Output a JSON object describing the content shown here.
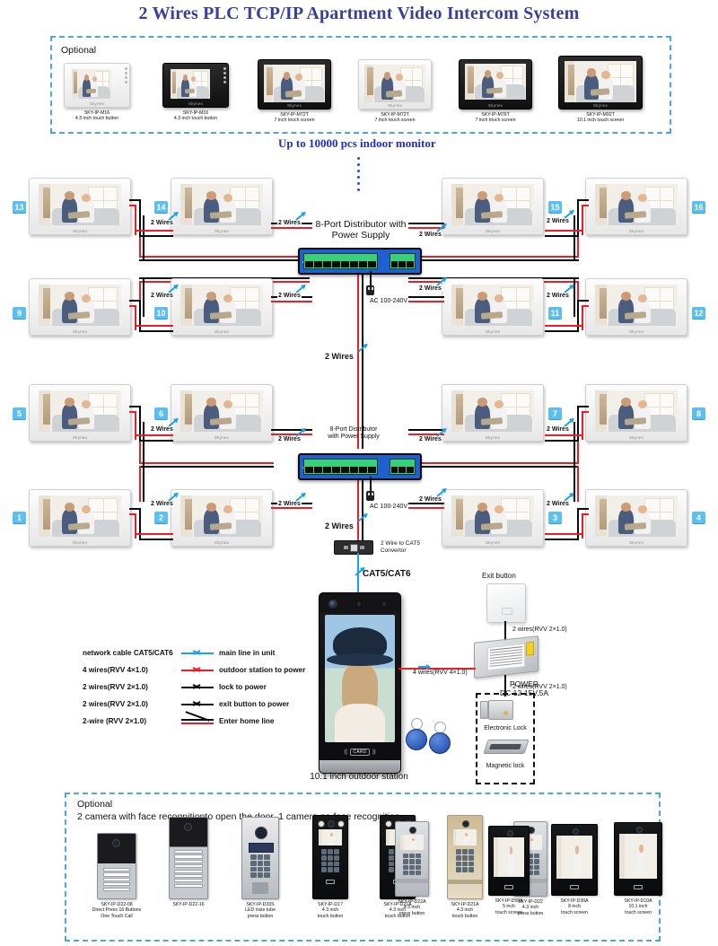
{
  "title": "2 Wires  PLC TCP/IP Apartment Video Intercom System",
  "optional_top": {
    "label": "Optional",
    "products": [
      {
        "model": "SKY-IP-M16",
        "desc": "4.3 inch touch button",
        "color": "white"
      },
      {
        "model": "SKY-IP-M16",
        "desc": "4.3 inch touch button",
        "color": "black"
      },
      {
        "model": "SKY-IP-M72T",
        "desc": "7 inch touch screen",
        "color": "black"
      },
      {
        "model": "SKY-IP-M72T",
        "desc": "7 inch touch screen",
        "color": "white"
      },
      {
        "model": "SKY-IP-M76T",
        "desc": "7 inch touch screen",
        "color": "black"
      },
      {
        "model": "SKY-IP-M92T",
        "desc": "10.1 inch touch screen",
        "color": "black"
      }
    ]
  },
  "capacity_note": "Up to 10000 pcs indoor monitor",
  "monitor_brand": "Skynex",
  "monitor_numbers": [
    "13",
    "14",
    "15",
    "16",
    "9",
    "10",
    "11",
    "12",
    "5",
    "6",
    "7",
    "8",
    "1",
    "2",
    "3",
    "4"
  ],
  "wire_label": "2 Wires",
  "distributors": [
    {
      "title_line1": "8-Port Distributor with",
      "title_line2": "Power Supply",
      "ac": "AC 100-240V"
    },
    {
      "title_line1": "8-Port Distributor",
      "title_line2": "with Power Supply",
      "ac": "AC 100-240V"
    }
  ],
  "converter": {
    "line1": "2 Wire to CAT5",
    "line2": "Convertor",
    "cable_label": "CAT5/CAT6"
  },
  "legend": [
    {
      "left": "network cable CAT5/CAT6",
      "right": "main line in unit",
      "color": "#19a3e8",
      "style": "single"
    },
    {
      "left": "4 wires(RVV 4×1.0)",
      "right": "outdoor station to power",
      "color": "#ee1c25",
      "style": "single"
    },
    {
      "left": "2 wires(RVV 2×1.0)",
      "right": "lock to power",
      "color": "#0a0a0a",
      "style": "single"
    },
    {
      "left": "2 wires(RVV 2×1.0)",
      "right": "exit button to power",
      "color": "#0a0a0a",
      "style": "single"
    },
    {
      "left": "2-wire (RVV 2×1.0)",
      "right": "Enter home line",
      "color": "#0a0a0a",
      "style": "double"
    }
  ],
  "outdoor_station": {
    "caption": "10.1 inch outdoor station",
    "card_text": "CARD"
  },
  "door_hardware": {
    "exit_button_label": "Exit button",
    "exit_wire": "2 wires(RVV 2×1.0)",
    "power_wire": "4 wires(RVV 4×1.0)",
    "power_line1": "POWER",
    "power_line2": "DC 12-15V,5A",
    "lock_wire": "2 wires(RVV 2×1.0)",
    "electronic_lock": "Electronic Lock",
    "magnetic_lock": "Magnetic lock"
  },
  "optional_bottom": {
    "label": "Optional",
    "note": "2 camera with face recognitionto open the door, 1 camera no face recognition",
    "products": [
      {
        "model": "SKY-IP-D22-08",
        "desc": "Direct Press 16 Buttons",
        "desc2": "One Touch Call",
        "kind": "panel-btn",
        "tone": "silver"
      },
      {
        "model": "SKY-IP-D22-16",
        "desc": "",
        "desc2": "",
        "kind": "panel-btn16",
        "tone": "silver"
      },
      {
        "model": "SKY-IP-D33S",
        "desc": "LED nixie tube",
        "desc2": "press button",
        "kind": "keypad-nixie",
        "tone": "silver"
      },
      {
        "model": "SKY-IP-D17",
        "desc": "4.3 inch",
        "desc2": "touch button",
        "kind": "screen-keypad",
        "tone": "black"
      },
      {
        "model": "SKY-IP-D21A",
        "desc": "4.3 inch",
        "desc2": "touch button",
        "kind": "screen-keypad",
        "tone": "black"
      },
      {
        "model": "SKY-IP-D21A",
        "desc": "4.3 inch",
        "desc2": "touch button",
        "kind": "screen-keypad",
        "tone": "gold"
      },
      {
        "model": "SKY-IP-D22",
        "desc": "4.3 inch",
        "desc2": "press button",
        "kind": "screen-keypad",
        "tone": "silver"
      },
      {
        "model": "SKY-IP-D22A",
        "desc": "4.3 inch",
        "desc2": "press button",
        "kind": "screen-keypad",
        "tone": "silver"
      },
      {
        "model": "SKY-IP-D50A",
        "desc": "5 inch",
        "desc2": "touch screen",
        "kind": "slim-screen",
        "tone": "black"
      },
      {
        "model": "SKY-IP-D30A",
        "desc": "8 inch",
        "desc2": "touch screen",
        "kind": "slim-screen",
        "tone": "black"
      },
      {
        "model": "SKY-IP-D10A",
        "desc": "10.1 inch",
        "desc2": "touch screen",
        "kind": "slim-screen",
        "tone": "black"
      }
    ]
  },
  "colors": {
    "title": "#3b3f9c",
    "badge": "#5bc0ef",
    "wire_red": "#ee1c25",
    "wire_black": "#0a0a0a",
    "wire_blue": "#19a3e8",
    "dashed_border": "#4aa8e0"
  }
}
